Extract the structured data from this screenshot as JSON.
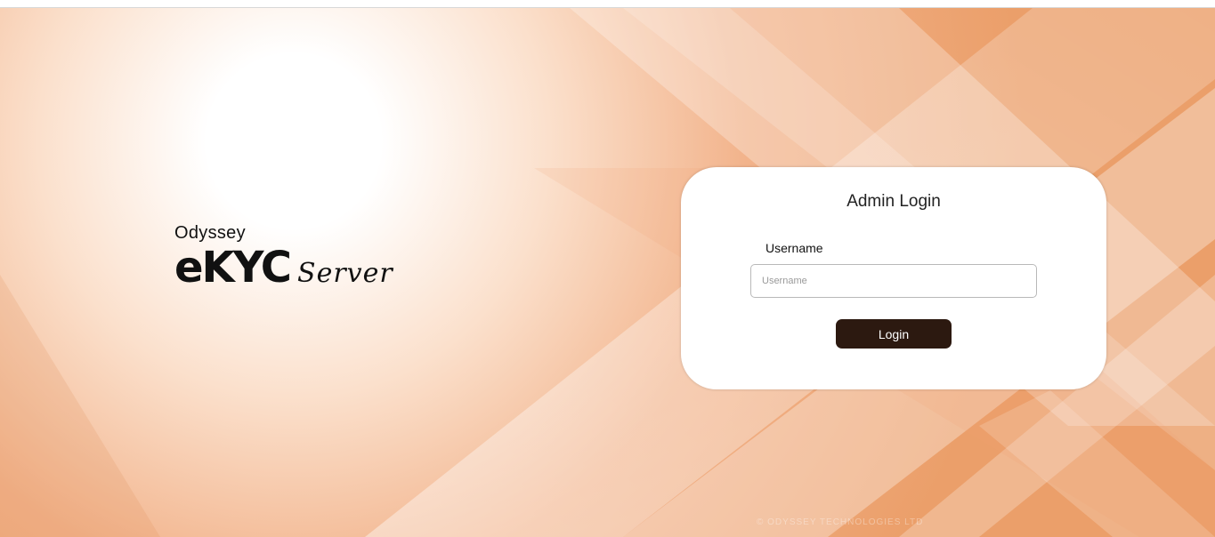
{
  "brand": {
    "company": "Odyssey",
    "product": "eKYC",
    "suffix": "Server"
  },
  "login_card": {
    "title": "Admin Login",
    "username_label": "Username",
    "username_placeholder": "Username",
    "username_value": "",
    "login_button": "Login"
  },
  "footer": {
    "copyright": "© ODYSSEY TECHNOLOGIES LTD"
  },
  "colors": {
    "accent_orange": "#f0a36f",
    "button_dark_brown": "#2c1910",
    "card_background": "#ffffff"
  }
}
